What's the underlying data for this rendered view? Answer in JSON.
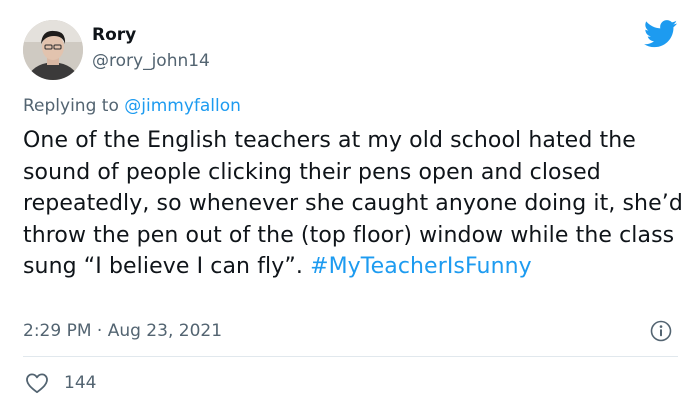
{
  "tweet": {
    "author_name": "Rory",
    "author_handle": "@rory_john14",
    "replying_prefix": "Replying to",
    "replying_to": "@jimmyfallon",
    "text": "One of the English teachers at my old school hated the sound of people clicking their pens open and closed repeatedly, so whenever she caught anyone doing it, she’d throw the pen out of the (top floor) window while the class sung “I believe I can fly”.",
    "hashtag": "#MyTeacherIsFunny",
    "timestamp": "2:29 PM · Aug 23, 2021",
    "like_count": "144"
  },
  "icons": {
    "brand": "twitter-bird-icon",
    "info": "info-icon",
    "like": "heart-icon"
  },
  "colors": {
    "brand": "#1d9bf0",
    "secondary_text": "#536471",
    "primary_text": "#0f1419",
    "divider": "#e1e8ed"
  }
}
